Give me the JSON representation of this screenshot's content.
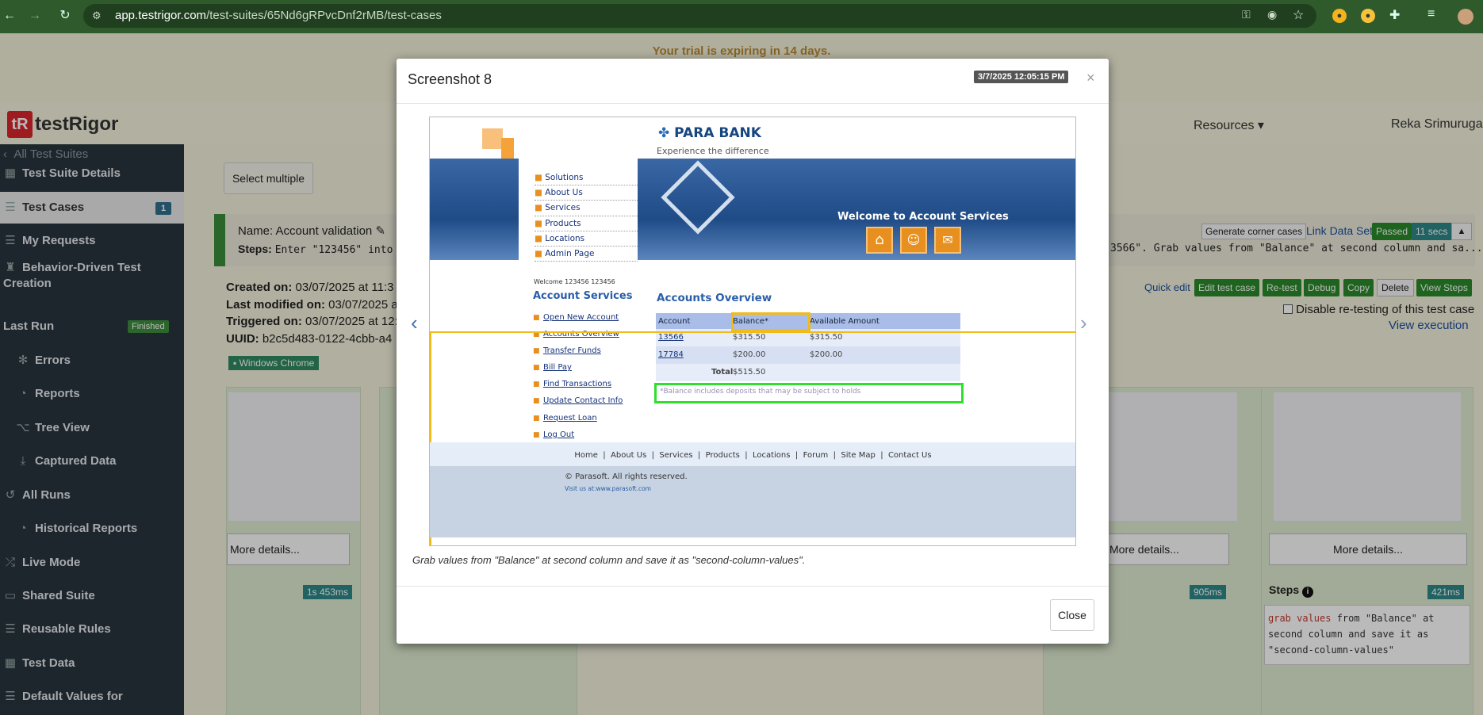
{
  "browser": {
    "url_domain": "app.testrigor.com",
    "url_path": "/test-suites/65Nd6gRPvcDnf2rMB/test-cases"
  },
  "trial_banner": "Your trial is expiring in 14 days.",
  "header": {
    "logo_mark": "tR",
    "logo_text": "testRigor",
    "resources": "Resources",
    "user": "Reka Srimurugan"
  },
  "sidebar": {
    "back": "All Test Suites",
    "items": [
      {
        "label": "Test Suite Details",
        "icon": "table-icon"
      },
      {
        "label": "Test Cases",
        "icon": "list-icon",
        "badge": "1"
      },
      {
        "label": "My Requests",
        "icon": "list-icon"
      },
      {
        "label": "Behavior-Driven Test",
        "label2": "Creation",
        "icon": "robot-icon"
      },
      {
        "label": "Last Run",
        "badge": "Finished"
      },
      {
        "label": "Errors",
        "icon": "bug-icon"
      },
      {
        "label": "Reports",
        "icon": "pie-icon"
      },
      {
        "label": "Tree View",
        "icon": "tree-icon"
      },
      {
        "label": "Captured Data",
        "icon": "download-icon"
      },
      {
        "label": "All Runs",
        "icon": "history-icon"
      },
      {
        "label": "Historical Reports",
        "icon": "pie-icon"
      },
      {
        "label": "Live Mode",
        "icon": "shuffle-icon"
      },
      {
        "label": "Shared Suite",
        "icon": "folder-icon"
      },
      {
        "label": "Reusable Rules",
        "icon": "list-icon"
      },
      {
        "label": "Test Data",
        "icon": "table-icon"
      },
      {
        "label": "Default Values for",
        "icon": "list-icon"
      }
    ]
  },
  "content": {
    "select_multiple": "Select multiple",
    "name_label": "Name:",
    "name_value": "Account validation",
    "steps_label": "Steps:",
    "steps_preview": "Enter \"123456\" into",
    "steps_tail": "3566\". Grab values from \"Balance\" at second column and sa...",
    "created_label": "Created on:",
    "created_value": "03/07/2025 at 11:3",
    "modified_label": "Last modified on:",
    "modified_value": "03/07/2025 at",
    "triggered_label": "Triggered on:",
    "triggered_value": "03/07/2025 at 12:",
    "uuid_label": "UUID:",
    "uuid_value": "b2c5d483-0122-4cbb-a4",
    "browser_badge": "Windows Chrome",
    "generate_corner": "Generate corner cases",
    "link_data_set": "Link Data Set",
    "passed": "Passed",
    "duration": "11 secs",
    "quick_edit": "Quick edit",
    "actions": [
      "Edit test case",
      "Re-test",
      "Debug",
      "Copy",
      "Delete",
      "View Steps"
    ],
    "disable_retest": "Disable re-testing of this test case",
    "view_execution": "View execution",
    "more_details": "More details...",
    "card_times": [
      "1s 453ms",
      "905ms",
      "421ms"
    ],
    "steps_title": "Steps",
    "steps_code_kw": "grab values",
    "steps_code_rest": " from \"Balance\" at second column and save it as \"second-column-values\""
  },
  "modal": {
    "title": "Screenshot 8",
    "timestamp": "3/7/2025 12:05:15 PM",
    "caption": "Grab values from \"Balance\" at second column and save it as \"second-column-values\".",
    "close_button": "Close"
  },
  "parabank": {
    "brand": "PARA BANK",
    "tagline": "Experience the difference",
    "menu": [
      "Solutions",
      "About Us",
      "Services",
      "Products",
      "Locations",
      "Admin Page"
    ],
    "welcome_banner": "Welcome to Account Services",
    "welcome_user": "Welcome 123456 123456",
    "services_title": "Account Services",
    "services": [
      "Open New Account",
      "Accounts Overview",
      "Transfer Funds",
      "Bill Pay",
      "Find Transactions",
      "Update Contact Info",
      "Request Loan",
      "Log Out"
    ],
    "overview_title": "Accounts Overview",
    "headers": [
      "Account",
      "Balance*",
      "Available Amount"
    ],
    "rows": [
      {
        "account": "13566",
        "balance": "$315.50",
        "available": "$315.50"
      },
      {
        "account": "17784",
        "balance": "$200.00",
        "available": "$200.00"
      }
    ],
    "total_label": "Total",
    "total_value": "$515.50",
    "note": "*Balance includes deposits that may be subject to holds",
    "footer_links": [
      "Home",
      "About Us",
      "Services",
      "Products",
      "Locations",
      "Forum",
      "Site Map",
      "Contact Us"
    ],
    "copyright": "© Parasoft. All rights reserved.",
    "visit": "Visit us at:",
    "visit_url": "www.parasoft.com"
  }
}
